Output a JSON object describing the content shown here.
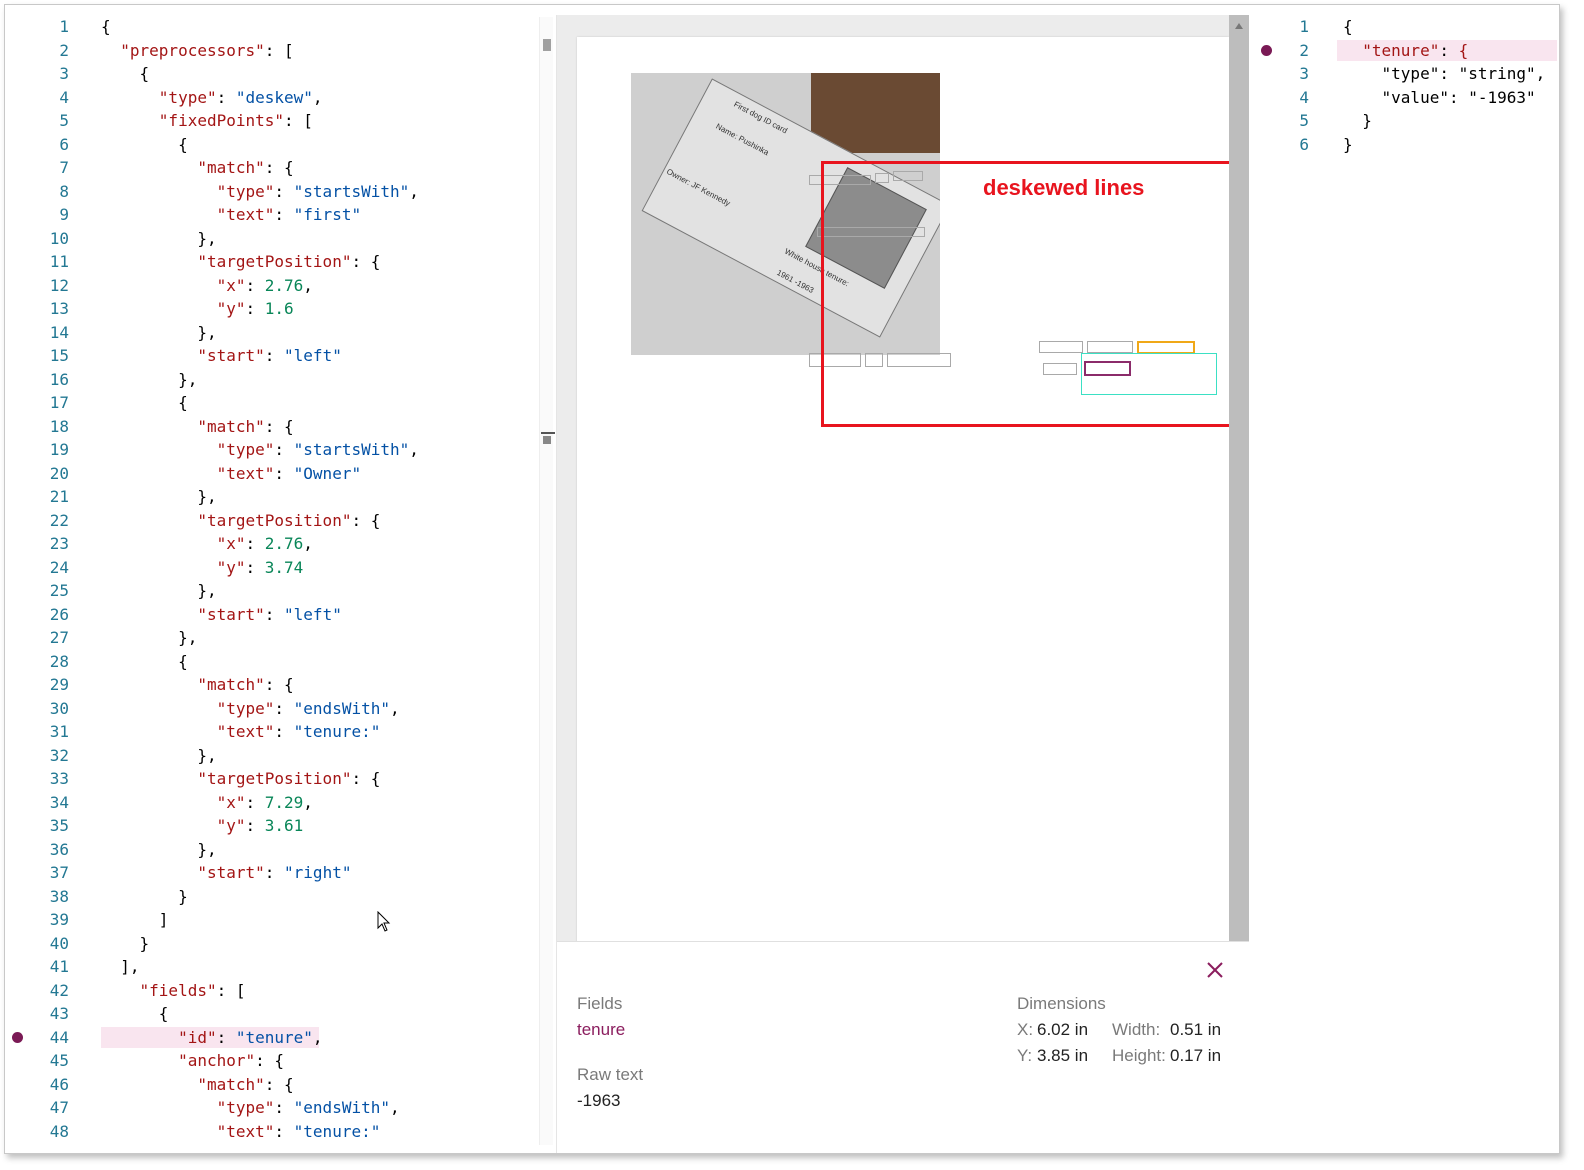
{
  "left_editor": {
    "breakpoint_line": "44",
    "lines": [
      {
        "n": "1",
        "html": "<span class=\"p\">{</span>"
      },
      {
        "n": "2",
        "html": "  <span class=\"k\">\"preprocessors\"</span><span class=\"p\">: [</span>"
      },
      {
        "n": "3",
        "html": "    <span class=\"p\">{</span>"
      },
      {
        "n": "4",
        "html": "      <span class=\"k\">\"type\"</span><span class=\"p\">: </span><span class=\"s\">\"deskew\"</span><span class=\"p\">,</span>"
      },
      {
        "n": "5",
        "html": "      <span class=\"k\">\"fixedPoints\"</span><span class=\"p\">: [</span>"
      },
      {
        "n": "6",
        "html": "        <span class=\"p\">{</span>"
      },
      {
        "n": "7",
        "html": "          <span class=\"k\">\"match\"</span><span class=\"p\">: {</span>"
      },
      {
        "n": "8",
        "html": "            <span class=\"k\">\"type\"</span><span class=\"p\">: </span><span class=\"s\">\"startsWith\"</span><span class=\"p\">,</span>"
      },
      {
        "n": "9",
        "html": "            <span class=\"k\">\"text\"</span><span class=\"p\">: </span><span class=\"s\">\"first\"</span>"
      },
      {
        "n": "10",
        "html": "          <span class=\"p\">},</span>"
      },
      {
        "n": "11",
        "html": "          <span class=\"k\">\"targetPosition\"</span><span class=\"p\">: {</span>"
      },
      {
        "n": "12",
        "html": "            <span class=\"k\">\"x\"</span><span class=\"p\">: </span><span class=\"n\">2.76</span><span class=\"p\">,</span>"
      },
      {
        "n": "13",
        "html": "            <span class=\"k\">\"y\"</span><span class=\"p\">: </span><span class=\"n\">1.6</span>"
      },
      {
        "n": "14",
        "html": "          <span class=\"p\">},</span>"
      },
      {
        "n": "15",
        "html": "          <span class=\"k\">\"start\"</span><span class=\"p\">: </span><span class=\"s\">\"left\"</span>"
      },
      {
        "n": "16",
        "html": "        <span class=\"p\">},</span>"
      },
      {
        "n": "17",
        "html": "        <span class=\"p\">{</span>"
      },
      {
        "n": "18",
        "html": "          <span class=\"k\">\"match\"</span><span class=\"p\">: {</span>"
      },
      {
        "n": "19",
        "html": "            <span class=\"k\">\"type\"</span><span class=\"p\">: </span><span class=\"s\">\"startsWith\"</span><span class=\"p\">,</span>"
      },
      {
        "n": "20",
        "html": "            <span class=\"k\">\"text\"</span><span class=\"p\">: </span><span class=\"s\">\"Owner\"</span>"
      },
      {
        "n": "21",
        "html": "          <span class=\"p\">},</span>"
      },
      {
        "n": "22",
        "html": "          <span class=\"k\">\"targetPosition\"</span><span class=\"p\">: {</span>"
      },
      {
        "n": "23",
        "html": "            <span class=\"k\">\"x\"</span><span class=\"p\">: </span><span class=\"n\">2.76</span><span class=\"p\">,</span>"
      },
      {
        "n": "24",
        "html": "            <span class=\"k\">\"y\"</span><span class=\"p\">: </span><span class=\"n\">3.74</span>"
      },
      {
        "n": "25",
        "html": "          <span class=\"p\">},</span>"
      },
      {
        "n": "26",
        "html": "          <span class=\"k\">\"start\"</span><span class=\"p\">: </span><span class=\"s\">\"left\"</span>"
      },
      {
        "n": "27",
        "html": "        <span class=\"p\">},</span>"
      },
      {
        "n": "28",
        "html": "        <span class=\"p\">{</span>"
      },
      {
        "n": "29",
        "html": "          <span class=\"k\">\"match\"</span><span class=\"p\">: {</span>"
      },
      {
        "n": "30",
        "html": "            <span class=\"k\">\"type\"</span><span class=\"p\">: </span><span class=\"s\">\"endsWith\"</span><span class=\"p\">,</span>"
      },
      {
        "n": "31",
        "html": "            <span class=\"k\">\"text\"</span><span class=\"p\">: </span><span class=\"s\">\"tenure:\"</span>"
      },
      {
        "n": "32",
        "html": "          <span class=\"p\">},</span>"
      },
      {
        "n": "33",
        "html": "          <span class=\"k\">\"targetPosition\"</span><span class=\"p\">: {</span>"
      },
      {
        "n": "34",
        "html": "            <span class=\"k\">\"x\"</span><span class=\"p\">: </span><span class=\"n\">7.29</span><span class=\"p\">,</span>"
      },
      {
        "n": "35",
        "html": "            <span class=\"k\">\"y\"</span><span class=\"p\">: </span><span class=\"n\">3.61</span>"
      },
      {
        "n": "36",
        "html": "          <span class=\"p\">},</span>"
      },
      {
        "n": "37",
        "html": "          <span class=\"k\">\"start\"</span><span class=\"p\">: </span><span class=\"s\">\"right\"</span>"
      },
      {
        "n": "38",
        "html": "        <span class=\"p\">}</span>"
      },
      {
        "n": "39",
        "html": "      <span class=\"p\">]</span>"
      },
      {
        "n": "40",
        "html": "    <span class=\"p\">}</span>"
      },
      {
        "n": "41",
        "html": "  <span class=\"p\">],</span>"
      },
      {
        "n": "42",
        "html": "    <span class=\"k\">\"fields\"</span><span class=\"p\">: [</span>"
      },
      {
        "n": "43",
        "html": "      <span class=\"p\">{</span>"
      },
      {
        "n": "44",
        "html": "        <span class=\"k\">\"id\"</span><span class=\"p\">: </span><span class=\"s\">\"tenure\"</span><span class=\"p\">,</span>"
      },
      {
        "n": "45",
        "html": "        <span class=\"k\">\"anchor\"</span><span class=\"p\">: {</span>"
      },
      {
        "n": "46",
        "html": "          <span class=\"k\">\"match\"</span><span class=\"p\">: {</span>"
      },
      {
        "n": "47",
        "html": "            <span class=\"k\">\"type\"</span><span class=\"p\">: </span><span class=\"s\">\"endsWith\"</span><span class=\"p\">,</span>"
      },
      {
        "n": "48",
        "html": "            <span class=\"k\">\"text\"</span><span class=\"p\">: </span><span class=\"s\">\"tenure:\"</span>"
      }
    ]
  },
  "right_editor": {
    "breakpoint_line": "2",
    "lines": [
      {
        "n": "1",
        "html": "<span class=\"p\">{</span>"
      },
      {
        "n": "2",
        "html": "  <span class=\"k\">\"tenure\"</span><span class=\"p\">: </span><span class=\"k\">{</span>"
      },
      {
        "n": "3",
        "html": "    <span class=\"p\">\"type\": \"string\",</span>"
      },
      {
        "n": "4",
        "html": "    <span class=\"p\">\"value\": \"-1963\"</span>"
      },
      {
        "n": "5",
        "html": "  <span class=\"p\">}</span>"
      },
      {
        "n": "6",
        "html": "<span class=\"p\">}</span>"
      }
    ]
  },
  "preview": {
    "annotation_label": "deskewed lines",
    "card_lines": [
      "First dog ID card",
      "Name: Pushinka",
      "Owner: JF Kennedy",
      "White house tenure:",
      "1961 -1963"
    ]
  },
  "details": {
    "fields_label": "Fields",
    "field_name": "tenure",
    "raw_text_label": "Raw text",
    "raw_text_value": "-1963",
    "dimensions_label": "Dimensions",
    "x_label": "X:",
    "x_value": "6.02 in",
    "y_label": "Y:",
    "y_value": "3.85 in",
    "width_label": "Width:",
    "width_value": "0.51 in",
    "height_label": "Height:",
    "height_value": "0.17 in"
  },
  "colors": {
    "annotation_red": "#e8141e",
    "field_highlight": "#8b1d5e",
    "breakpoint": "#7a1a55"
  }
}
